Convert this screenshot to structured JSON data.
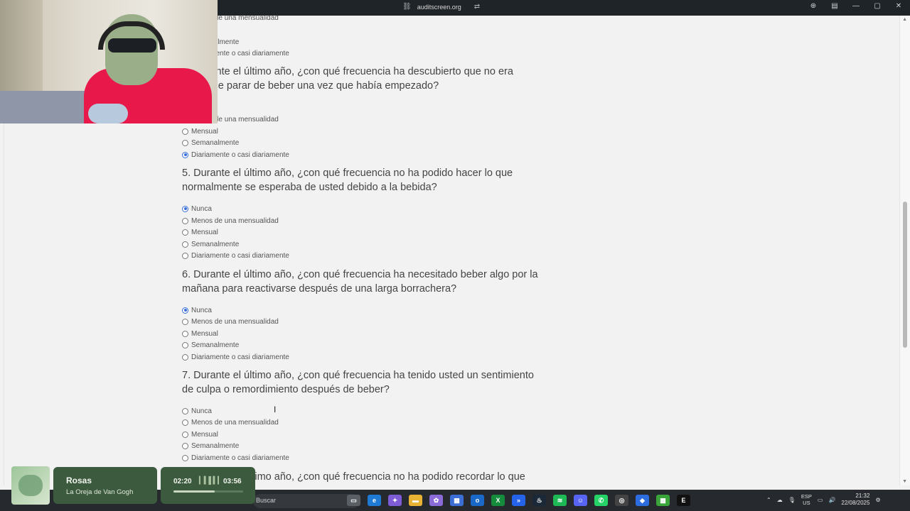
{
  "browser": {
    "url": "auditscreen.org",
    "tab_info": "",
    "controls": [
      "⊕",
      "▤",
      "—",
      "▢",
      "✕"
    ]
  },
  "survey": {
    "top_options": [
      {
        "label": "Menos de una mensualidad",
        "checked": false
      },
      {
        "label": "Semanalmente",
        "checked": false
      },
      {
        "label": "Diariamente o casi diariamente",
        "checked": false
      }
    ],
    "q4": {
      "text": "4. Durante el último año, ¿con qué frecuencia ha descubierto que no era capaz de parar de beber una vez que había empezado?",
      "options": [
        {
          "label": "Menos de una mensualidad",
          "checked": false
        },
        {
          "label": "Mensual",
          "checked": false
        },
        {
          "label": "Semanalmente",
          "checked": false
        },
        {
          "label": "Diariamente o casi diariamente",
          "checked": true
        }
      ]
    },
    "q5": {
      "text": "5. Durante el último año, ¿con qué frecuencia no ha podido hacer lo que normalmente se esperaba de usted debido a la bebida?",
      "options": [
        {
          "label": "Nunca",
          "checked": true
        },
        {
          "label": "Menos de una mensualidad",
          "checked": false
        },
        {
          "label": "Mensual",
          "checked": false
        },
        {
          "label": "Semanalmente",
          "checked": false
        },
        {
          "label": "Diariamente o casi diariamente",
          "checked": false
        }
      ]
    },
    "q6": {
      "text": "6. Durante el último año, ¿con qué frecuencia ha necesitado beber algo por la mañana para reactivarse después de una larga borrachera?",
      "options": [
        {
          "label": "Nunca",
          "checked": true
        },
        {
          "label": "Menos de una mensualidad",
          "checked": false
        },
        {
          "label": "Mensual",
          "checked": false
        },
        {
          "label": "Semanalmente",
          "checked": false
        },
        {
          "label": "Diariamente o casi diariamente",
          "checked": false
        }
      ]
    },
    "q7": {
      "text": "7. Durante el último año, ¿con qué frecuencia ha tenido usted un sentimiento de culpa o remordimiento después de beber?",
      "options": [
        {
          "label": "Nunca",
          "checked": false
        },
        {
          "label": "Menos de una mensualidad",
          "checked": false
        },
        {
          "label": "Mensual",
          "checked": false
        },
        {
          "label": "Semanalmente",
          "checked": false
        },
        {
          "label": "Diariamente o casi diariamente",
          "checked": false
        }
      ]
    },
    "q8_partial": "8. Durante el último año, ¿con qué frecuencia no ha podido recordar lo que"
  },
  "music": {
    "title": "Rosas",
    "artist": "La Oreja de Van Gogh",
    "elapsed": "02:20",
    "duration": "03:56",
    "progress": 0.59
  },
  "taskbar": {
    "search_placeholder": "Buscar",
    "lang_top": "ESP",
    "lang_bottom": "US",
    "time": "21:32",
    "date": "22/08/2025"
  }
}
